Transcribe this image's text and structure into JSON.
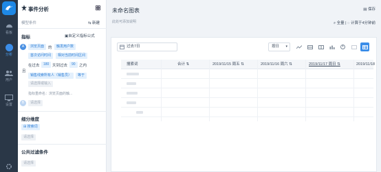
{
  "rail": {
    "items": [
      {
        "label": "看板"
      },
      {
        "label": "分析"
      },
      {
        "label": "用户"
      },
      {
        "label": "设置"
      }
    ]
  },
  "panel": {
    "title": "事件分析",
    "template_label": "模型条件",
    "new_label": "新建",
    "metrics_title": "指标",
    "custom_formula": "自定义指标公式",
    "metric_a": {
      "event": "浏览页面",
      "of": "的",
      "measure": "触发用户数",
      "tag1": "首次访问时间",
      "tag2": "相对当前时间区间",
      "range_prefix": "在过去",
      "range_value": "180",
      "range_mid": "天到过去",
      "range_value2": "90",
      "range_suffix": "之内",
      "and_label": "且",
      "tag3": "销售线索所有人（销售员）",
      "op": "等于",
      "value_placeholder": "请选择或输入",
      "name_hint": "指标重命名：浏览页面的触..."
    },
    "add_event": "请选择",
    "group_title": "细分维度",
    "group_tag": "搜索词",
    "group_add": "请选择",
    "filter_title": "公共过滤条件",
    "filter_add": "请选择"
  },
  "main": {
    "title": "未命名图表",
    "subtitle": "此处可添加说明",
    "save_label": "保存",
    "fullscreen_label": "全量",
    "compute_label": "计算于4分钟前",
    "date_range": "过去7日",
    "sort_label": "按日",
    "table": {
      "columns": [
        "搜索词",
        "合计",
        "2019/11/15 周五",
        "2019/11/16 周六",
        "2019/11/17 周日",
        "2019/11/18"
      ]
    }
  },
  "colors": {
    "accent": "#3b8de8",
    "rail_bg": "#2a3747",
    "tag_bg": "#e3f0fd"
  }
}
